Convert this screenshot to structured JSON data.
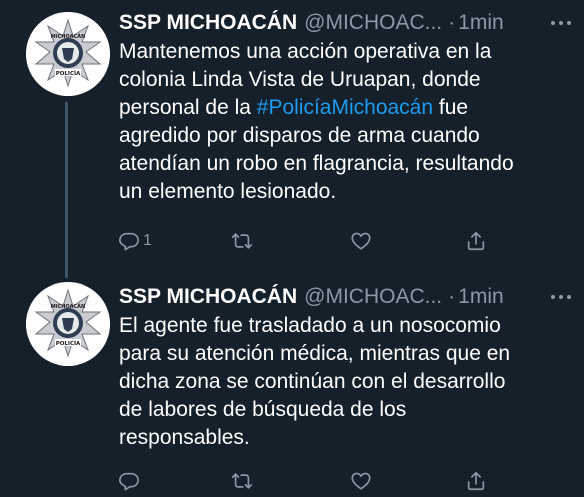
{
  "colors": {
    "background": "#15202b",
    "text_primary": "#ffffff",
    "text_secondary": "#8b98a5",
    "hashtag": "#1d9bf0",
    "thread_line": "#3d5466"
  },
  "tweets": [
    {
      "name": "SSP MICHOACÁN",
      "handle": "@MICHOAC...",
      "dot": "·",
      "time": "1min",
      "more_label": "···",
      "text_lines": [
        "Mantenemos una acción operativa en la",
        "colonia Linda Vista de Uruapan, donde",
        "personal de la ",
        "agredido por disparos de arma cuando",
        "atendían un robo en flagrancia, resultando",
        "un elemento lesionado."
      ],
      "hashtag": "#PolicíaMichoacán",
      "after_hashtag": " fue",
      "reply_count": "1",
      "avatar_icon": "police-badge",
      "avatar_text": "MICHOACÁN",
      "avatar_label": "POLICÍA"
    },
    {
      "name": "SSP MICHOACÁN",
      "handle": "@MICHOAC...",
      "dot": "·",
      "time": "1min",
      "more_label": "···",
      "text_lines": [
        "El agente fue trasladado a un nosocomio",
        "para su atención médica, mientras que en",
        "dicha zona se continúan con el desarrollo",
        "de labores de búsqueda de los",
        "responsables."
      ],
      "avatar_icon": "police-badge",
      "avatar_text": "MICHOACÁN",
      "avatar_label": "POLICÍA"
    }
  ],
  "icons": {
    "reply": "reply-icon",
    "retweet": "retweet-icon",
    "like": "like-icon",
    "share": "share-icon",
    "more": "more-icon"
  }
}
